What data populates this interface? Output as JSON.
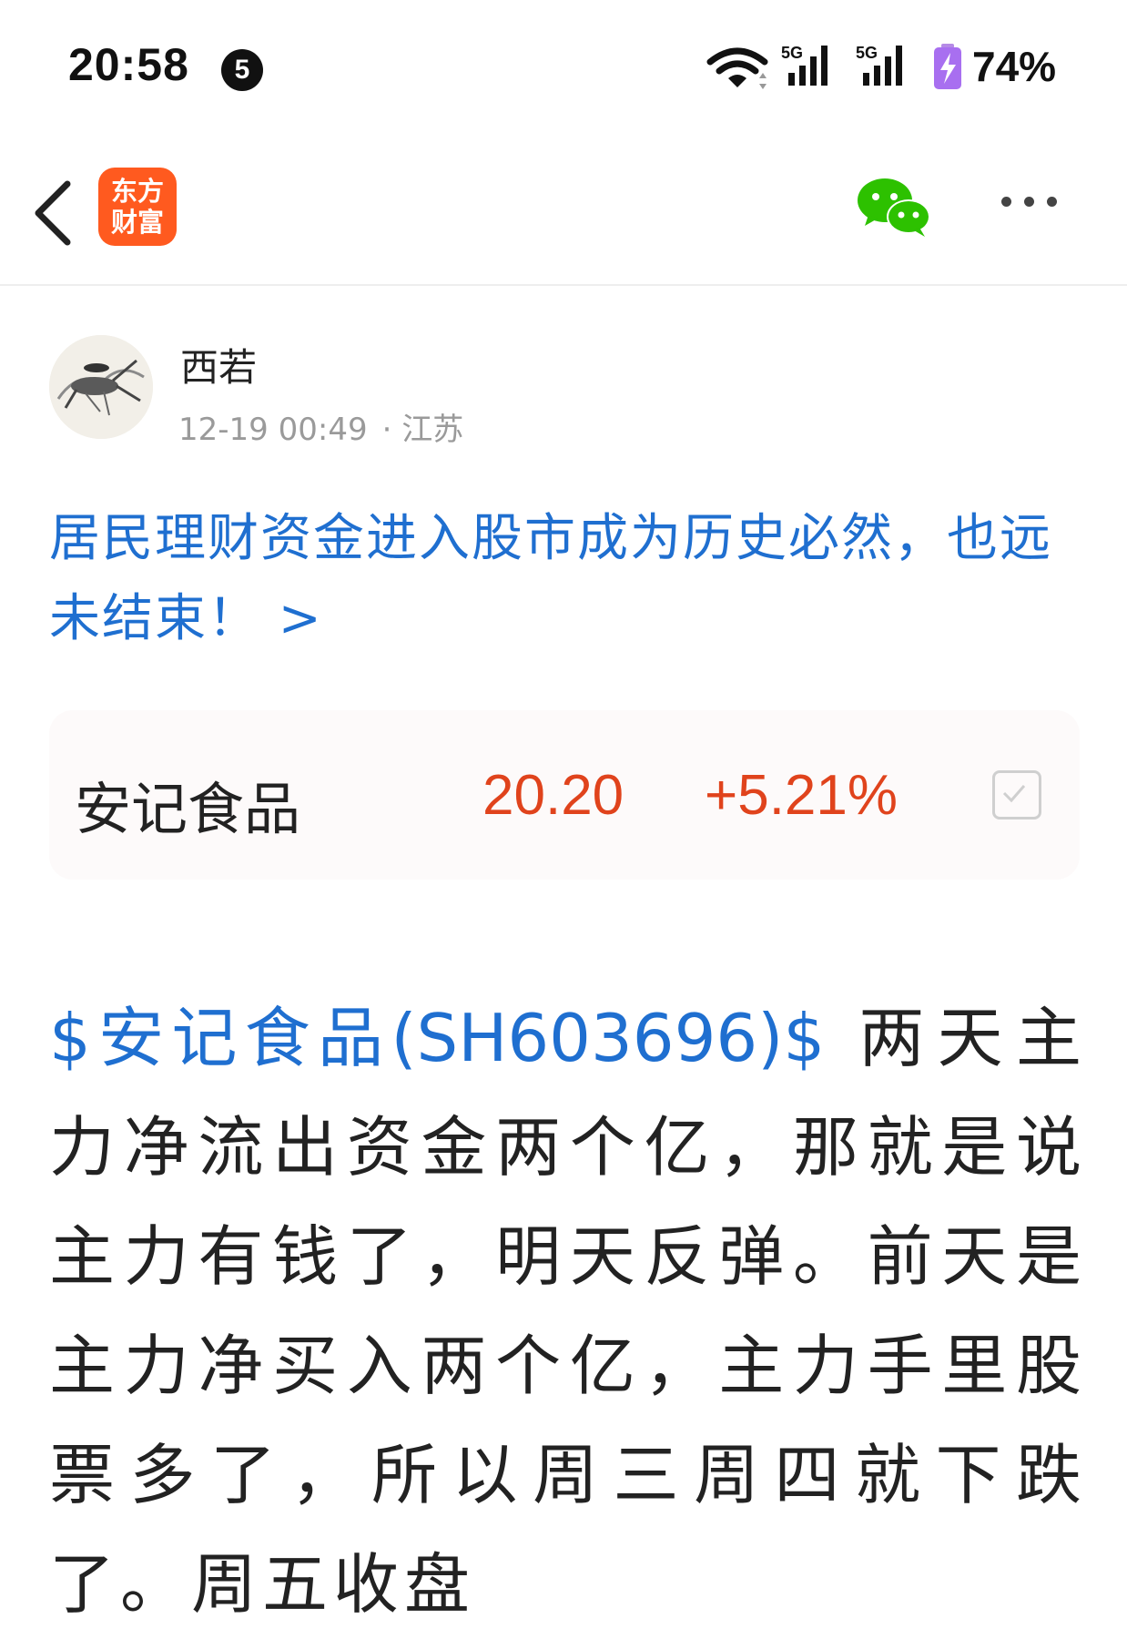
{
  "status_bar": {
    "time": "20:58",
    "notification_count": "5",
    "signal_1_label": "5G",
    "signal_2_label": "5G",
    "battery": "74%"
  },
  "nav": {
    "logo_line1": "东方",
    "logo_line2": "财富",
    "icons": [
      "back-icon",
      "wechat-icon",
      "more-icon"
    ]
  },
  "author": {
    "name": "西若",
    "datetime": "12-19 00:49",
    "location": "· 江苏"
  },
  "post": {
    "title": "居民理财资金进入股市成为历史必然，也远未结束！ >",
    "stock_link": "$安记食品(SH603696)$",
    "body": " 两天主力净流出资金两个亿，那就是说主力有钱了，明天反弹。前天是主力净买入两个亿，主力手里股票多了，所以周三周四就下跌了。周五收盘"
  },
  "stock_card": {
    "name": "安记食品",
    "price": "20.20",
    "change": "+5.21%"
  },
  "colors": {
    "link_blue": "#1f6fd0",
    "up_red": "#e0431c",
    "brand_orange": "#ff5a1f",
    "wechat_green": "#2dc100"
  }
}
